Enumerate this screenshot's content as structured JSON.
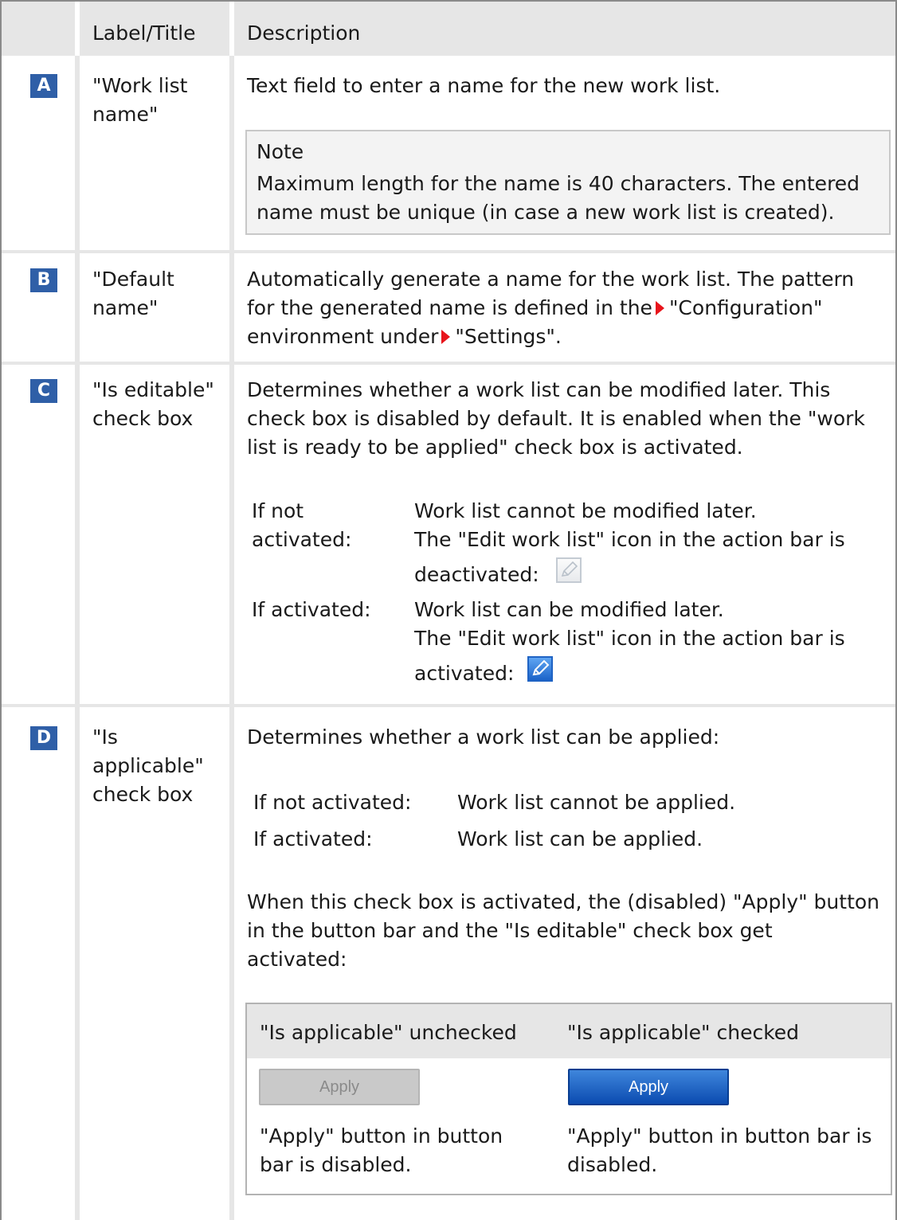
{
  "header": {
    "col_label": "Label/Title",
    "col_description": "Description"
  },
  "rows": [
    {
      "marker": "A",
      "label": [
        "\"Work list",
        "name\""
      ],
      "description": "Text field to enter a name for the new work list.",
      "note": {
        "title": "Note",
        "lines": [
          "Maximum length for the name is 40 characters. The entered",
          "name must be unique (in case a new work list is created)."
        ]
      }
    },
    {
      "marker": "B",
      "label": [
        "\"Default",
        "name\""
      ],
      "description_line1": "Automatically generate a name for the work list. The pattern",
      "description_line2_pre": "for the generated name is defined in the",
      "link_configuration": "\"Configuration\"",
      "description_line3_pre": "environment under",
      "link_settings": "\"Settings\"."
    },
    {
      "marker": "C",
      "label": [
        "\"Is editable\"",
        "check box"
      ],
      "description_lines": [
        "Determines whether a work list can be modified later. This",
        "check box is disabled by default. It is enabled when the \"work",
        "list is ready to be applied\" check box is activated."
      ],
      "states": [
        {
          "state": [
            "If not",
            "activated:"
          ],
          "text": [
            "Work list cannot be modified later.",
            "The \"Edit work list\" icon in the action bar is",
            "deactivated:"
          ],
          "icon": "pencil-disabled-icon"
        },
        {
          "state": [
            "If activated:"
          ],
          "text": [
            "Work list can be modified later.",
            "The \"Edit work list\" icon in the action bar is",
            "activated:"
          ],
          "icon": "pencil-enabled-icon"
        }
      ]
    },
    {
      "marker": "D",
      "label": [
        "\"Is",
        "applicable\"",
        "check box"
      ],
      "description": "Determines whether a work list can be applied:",
      "states": [
        {
          "state": "If not activated:",
          "text": "Work list cannot be applied."
        },
        {
          "state": "If activated:",
          "text": "Work list can be applied."
        }
      ],
      "after_lines": [
        "When this check box is activated, the (disabled) \"Apply\" button",
        "in the button bar and the \"Is editable\" check box get",
        "activated:"
      ],
      "comparison": {
        "col_unchecked": "\"Is applicable\" unchecked",
        "col_checked": "\"Is applicable\" checked",
        "button_label_disabled": "Apply",
        "button_label_enabled": "Apply",
        "caption_unchecked": [
          "\"Apply\" button in button",
          "bar is disabled."
        ],
        "caption_checked": [
          "\"Apply\" button in button bar is",
          "disabled."
        ]
      }
    }
  ]
}
